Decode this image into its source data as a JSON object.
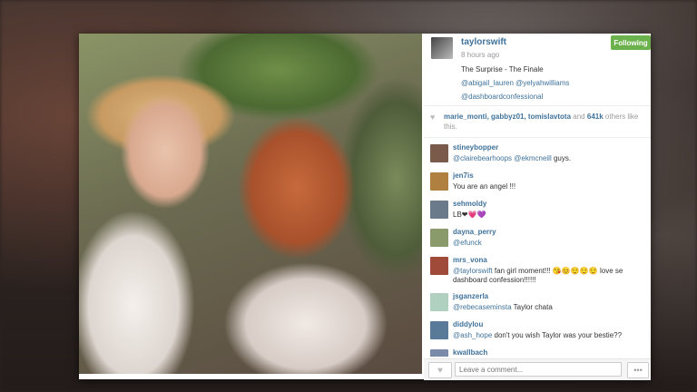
{
  "post": {
    "username": "taylorswift",
    "time": "8 hours ago",
    "follow_label": "Following",
    "caption": "The Surprise - The Finale",
    "mentions": [
      "@abigail_lauren @yelyahwilliams",
      "@dashboardconfessional"
    ]
  },
  "likes": {
    "users": "marie_monti, gabbyz01, tomislavtota",
    "and_text": "and",
    "count": "641k",
    "suffix": "others like this."
  },
  "comments": [
    {
      "user": "stineybopper",
      "mention": "@clairebearhoops @ekmcneill",
      "text": " guys.",
      "avatar_color": "#7a5a4a"
    },
    {
      "user": "jen7is",
      "mention": "",
      "text": "You are an angel !!!",
      "avatar_color": "#b08040"
    },
    {
      "user": "sehmoldy",
      "mention": "",
      "text": "LB❤💗💜",
      "avatar_color": "#6a7a8a"
    },
    {
      "user": "dayna_perry",
      "mention": "@efunck",
      "text": "",
      "avatar_color": "#8a9a6a"
    },
    {
      "user": "mrs_vona",
      "mention": "@taylorswift",
      "text": " fan girl moment!!! 😘😊😌😌😌 love se dashboard confession!!!!!!",
      "avatar_color": "#a04a3a"
    },
    {
      "user": "jsganzerla",
      "mention": "@rebecaseminsta",
      "text": " Taylor chata",
      "avatar_color": "#b0d0c0"
    },
    {
      "user": "diddylou",
      "mention": "@ash_hope",
      "text": " don't you wish Taylor was your bestie??",
      "avatar_color": "#5a7a9a"
    },
    {
      "user": "kwallbach",
      "mention": "",
      "text": "",
      "avatar_color": "#7a8aaa"
    }
  ],
  "footer": {
    "comment_placeholder": "Leave a comment...",
    "more_label": "•••"
  },
  "colors": {
    "link": "#3f729b",
    "follow": "#6bb24d"
  },
  "icons": {
    "like": "heart-icon",
    "more": "ellipsis-icon"
  }
}
